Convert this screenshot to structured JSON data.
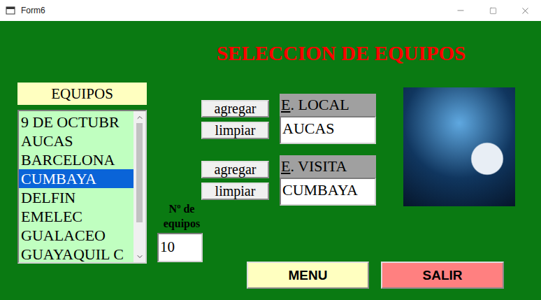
{
  "window": {
    "title": "Form6"
  },
  "heading": "SELECCION DE EQUIPOS",
  "teams_list": {
    "label": "EQUIPOS",
    "items": [
      {
        "name": "9 DE OCTUBR",
        "selected": false
      },
      {
        "name": "AUCAS",
        "selected": false
      },
      {
        "name": "BARCELONA",
        "selected": false
      },
      {
        "name": "CUMBAYA",
        "selected": true
      },
      {
        "name": "DELFIN",
        "selected": false
      },
      {
        "name": "EMELEC",
        "selected": false
      },
      {
        "name": "GUALACEO",
        "selected": false
      },
      {
        "name": "GUAYAQUIL C",
        "selected": false
      }
    ],
    "scroll": {
      "level": 0.78
    }
  },
  "local": {
    "add_button": "agregar",
    "clear_button": "limpiar",
    "label": "E. LOCAL",
    "access_key": "E",
    "value": "AUCAS"
  },
  "visitor": {
    "add_button": "agregar",
    "clear_button": "limpiar",
    "label": "E. VISITA",
    "access_key": "E",
    "value": "CUMBAYA"
  },
  "count": {
    "label": "Nº de equipos",
    "value": "10"
  },
  "buttons": [
    {
      "label": "MENU",
      "color": "#ffffc0"
    },
    {
      "label": "SALIR",
      "color": "#ff8080"
    }
  ]
}
